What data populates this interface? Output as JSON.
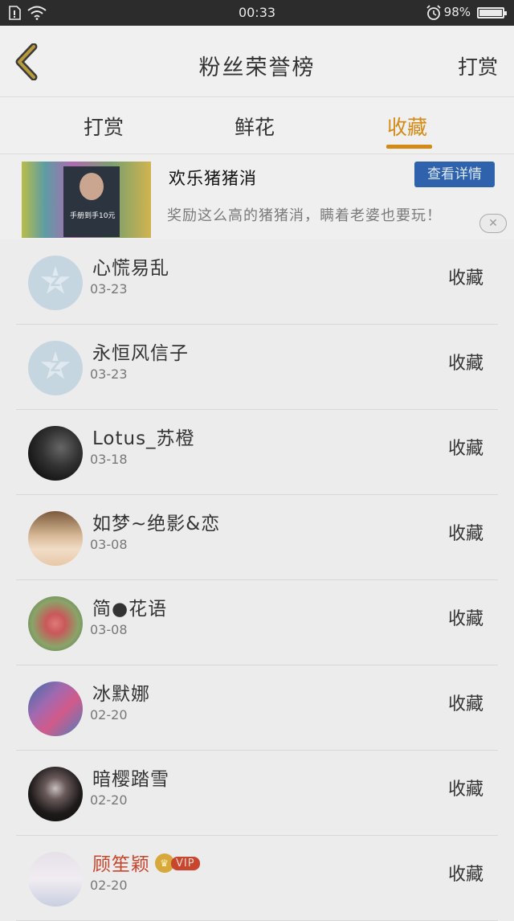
{
  "status_bar": {
    "time": "00:33",
    "battery": "98%"
  },
  "header": {
    "title": "粉丝荣誉榜",
    "right_action": "打赏"
  },
  "tabs": [
    {
      "label": "打赏",
      "active": false
    },
    {
      "label": "鲜花",
      "active": false
    },
    {
      "label": "收藏",
      "active": true
    }
  ],
  "accent_color": "#d58a16",
  "ad": {
    "title": "欢乐猪猪消",
    "button": "查看详情",
    "description": "奖励这么高的猪猪消，瞒着老婆也要玩！",
    "thumb_caption": "手册到手10元"
  },
  "list": [
    {
      "name": "心慌易乱",
      "date": "03-23",
      "action": "收藏"
    },
    {
      "name": "永恒风信子",
      "date": "03-23",
      "action": "收藏"
    },
    {
      "name": "Lotus_苏橙",
      "date": "03-18",
      "action": "收藏"
    },
    {
      "name": "如梦~绝影&恋",
      "date": "03-08",
      "action": "收藏"
    },
    {
      "name": "简●花语",
      "date": "03-08",
      "action": "收藏"
    },
    {
      "name": "冰默娜",
      "date": "02-20",
      "action": "收藏"
    },
    {
      "name": "暗樱踏雪",
      "date": "02-20",
      "action": "收藏"
    },
    {
      "name": "顾笙颖",
      "date": "02-20",
      "action": "收藏",
      "vip": "VIP"
    }
  ]
}
